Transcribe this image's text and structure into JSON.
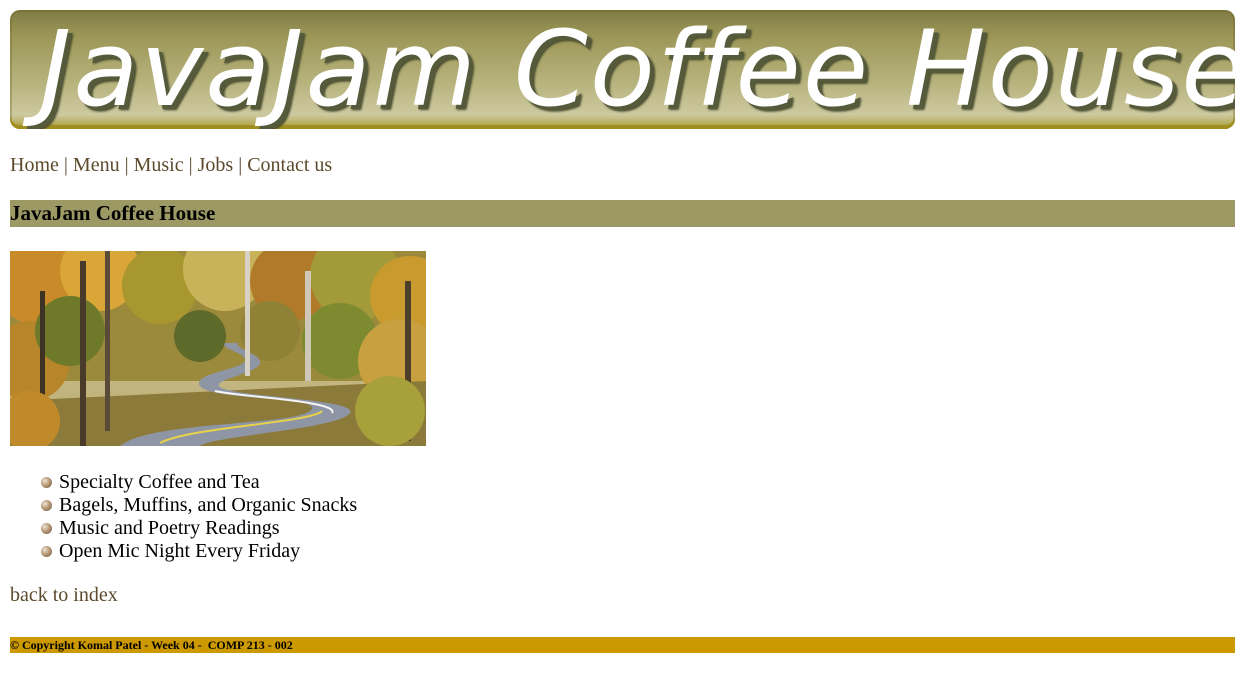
{
  "banner": {
    "title": "JavaJam Coffee House"
  },
  "nav": {
    "items": [
      {
        "label": "Home"
      },
      {
        "label": "Menu"
      },
      {
        "label": "Music"
      },
      {
        "label": "Jobs"
      },
      {
        "label": "Contact us"
      }
    ],
    "separator": "|"
  },
  "main": {
    "heading": "JavaJam Coffee House",
    "features": [
      "Specialty Coffee and Tea",
      "Bagels, Muffins, and Organic Snacks",
      "Music and Poetry Readings",
      "Open Mic Night Every Friday"
    ],
    "back_link": "back to index"
  },
  "footer": {
    "text": "© Copyright Komal Patel - Week 04 -  COMP 213 - 002"
  },
  "colors": {
    "link": "#5c4a2c",
    "heading_bar": "#9c9965",
    "footer_bar": "#cc9900",
    "banner_gold": "#a89a32"
  },
  "icons": {
    "bullet": "bead-bullet-icon"
  }
}
